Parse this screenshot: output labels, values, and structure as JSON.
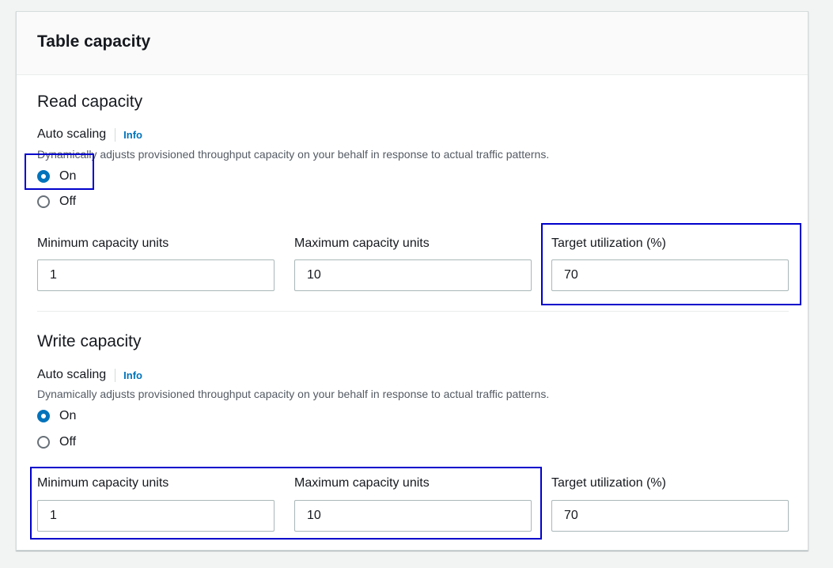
{
  "panel": {
    "title": "Table capacity"
  },
  "read": {
    "title": "Read capacity",
    "auto_scaling_label": "Auto scaling",
    "info_label": "Info",
    "description": "Dynamically adjusts provisioned throughput capacity on your behalf in response to actual traffic patterns.",
    "options": [
      {
        "label": "On",
        "checked": true
      },
      {
        "label": "Off",
        "checked": false
      }
    ],
    "min": {
      "label": "Minimum capacity units",
      "value": "1"
    },
    "max": {
      "label": "Maximum capacity units",
      "value": "10"
    },
    "target": {
      "label": "Target utilization (%)",
      "value": "70"
    }
  },
  "write": {
    "title": "Write capacity",
    "auto_scaling_label": "Auto scaling",
    "info_label": "Info",
    "description": "Dynamically adjusts provisioned throughput capacity on your behalf in response to actual traffic patterns.",
    "options": [
      {
        "label": "On",
        "checked": true
      },
      {
        "label": "Off",
        "checked": false
      }
    ],
    "min": {
      "label": "Minimum capacity units",
      "value": "1"
    },
    "max": {
      "label": "Maximum capacity units",
      "value": "10"
    },
    "target": {
      "label": "Target utilization (%)",
      "value": "70"
    }
  },
  "colors": {
    "accent": "#0073bb",
    "highlight": "#0000cc"
  }
}
